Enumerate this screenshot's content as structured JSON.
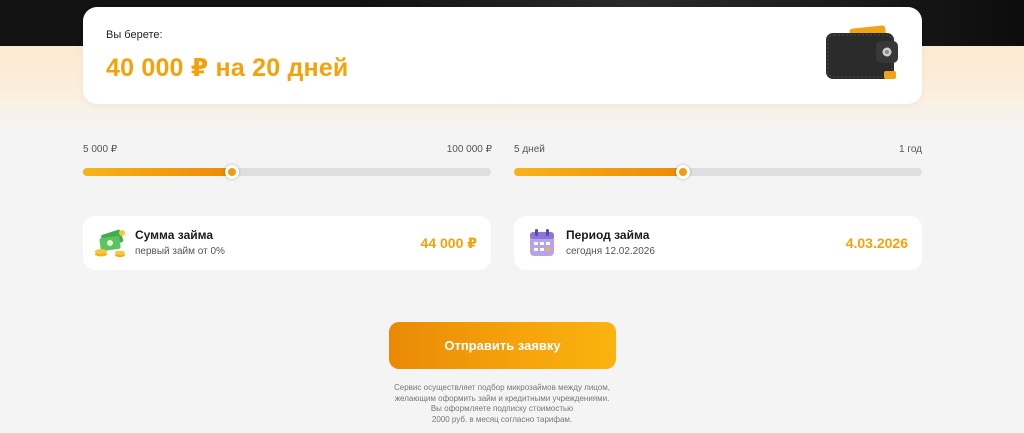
{
  "hero": {
    "label": "Вы берете:",
    "value": "40 000 ₽ на 20 дней"
  },
  "amount_slider": {
    "min_label": "5 000 ₽",
    "max_label": "100 000 ₽",
    "level_percent": 36.6
  },
  "period_slider": {
    "min_label": "5 дней",
    "max_label": "1 год",
    "level_percent": 41.5
  },
  "amount_card": {
    "icon": "money-stack-icon",
    "title": "Сумма займа",
    "subtitle": "первый займ от 0%",
    "value": "44 000 ₽"
  },
  "period_card": {
    "icon": "calendar-icon",
    "title": "Период займа",
    "subtitle": "сегодня 12.02.2026",
    "value": "4.03.2026"
  },
  "submit_label": "Отправить заявку",
  "disclaimer": [
    "Сервис осуществляет подбор микрозаймов между лицом,",
    "желающим оформить займ и кредитными учреждениями.",
    "Вы оформляете подписку стоимостью",
    "2000 руб. в месяц согласно тарифам."
  ],
  "colors": {
    "accent": "#f5a20a",
    "accent_dark": "#e98a06",
    "track": "#dedede",
    "background": "#f4f4f4"
  }
}
